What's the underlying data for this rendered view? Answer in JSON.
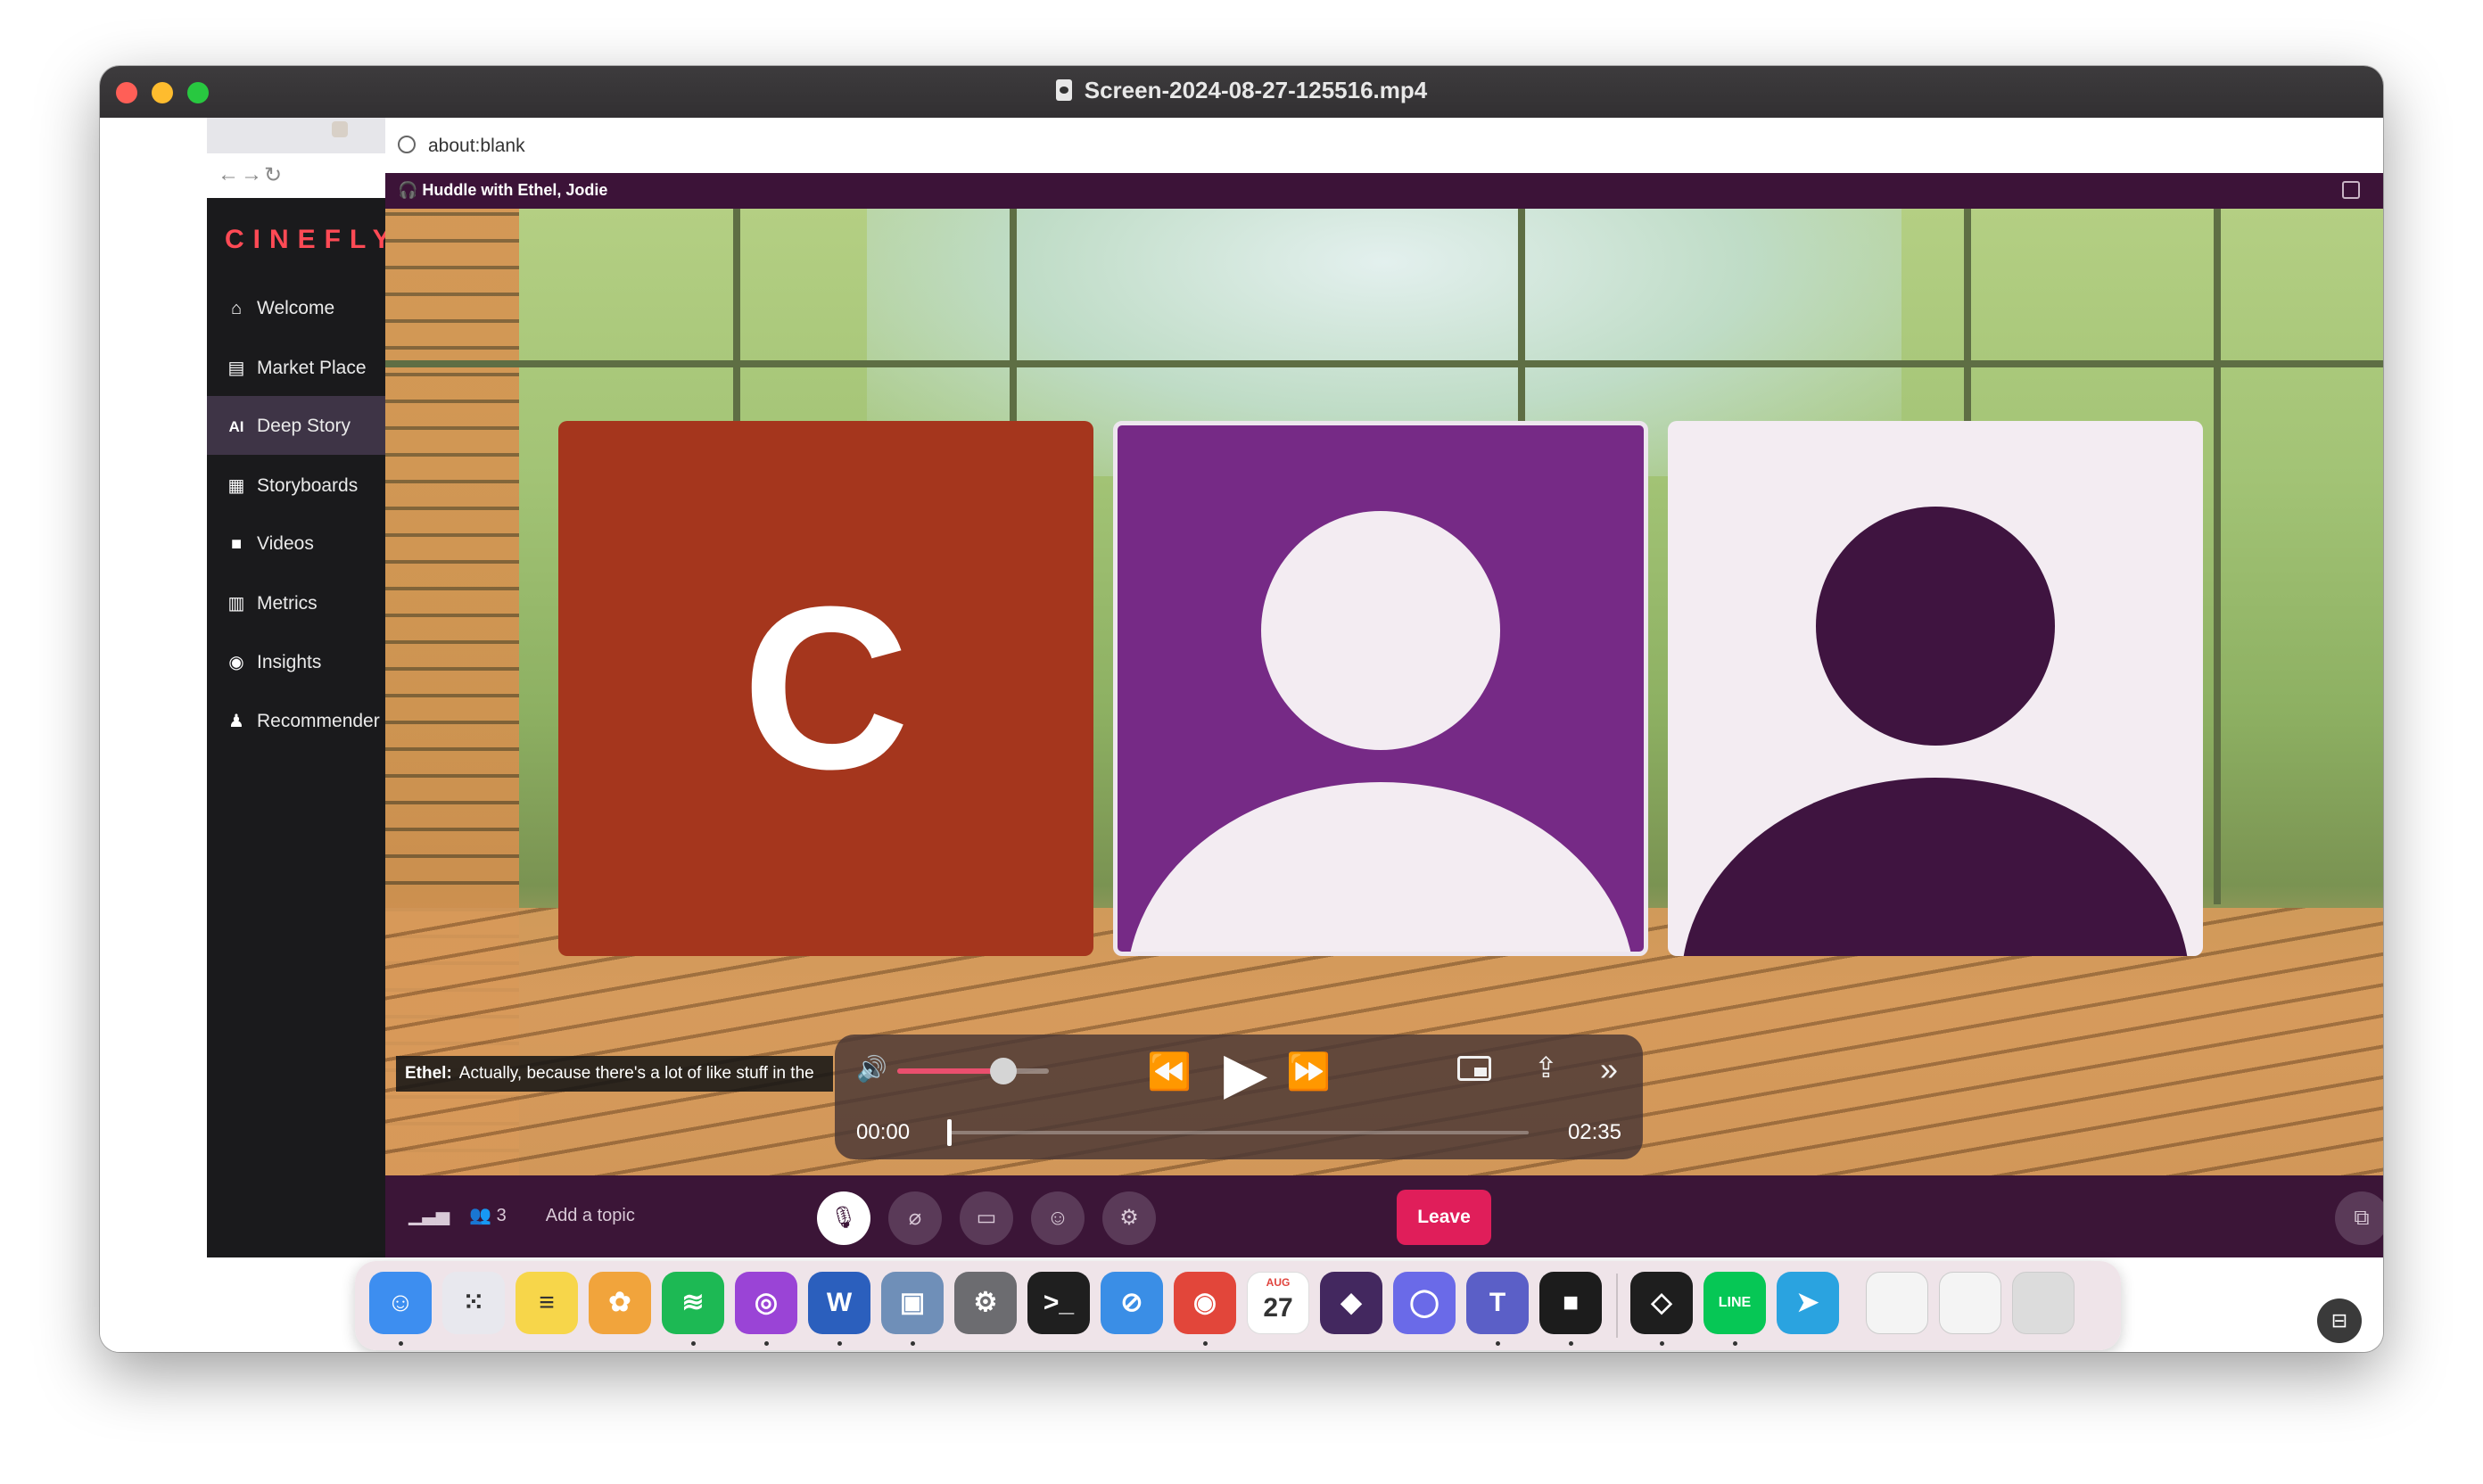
{
  "window": {
    "title": "Screen-2024-08-27-125516.mp4"
  },
  "browser": {
    "url": "about:blank"
  },
  "app": {
    "logo": "CINEFLY",
    "nav": [
      {
        "label": "Welcome",
        "icon": "home-icon",
        "glyph": "⌂"
      },
      {
        "label": "Market Place",
        "icon": "store-icon",
        "glyph": "▤"
      },
      {
        "label": "Deep Story",
        "icon": "ai-icon",
        "glyph": "AI",
        "active": true
      },
      {
        "label": "Storyboards",
        "icon": "grid-icon",
        "glyph": "▦"
      },
      {
        "label": "Videos",
        "icon": "video-icon",
        "glyph": "■"
      },
      {
        "label": "Metrics",
        "icon": "chart-icon",
        "glyph": "▥"
      },
      {
        "label": "Insights",
        "icon": "eye-icon",
        "glyph": "◉"
      },
      {
        "label": "Recommender",
        "icon": "person-icon",
        "glyph": "♟"
      }
    ]
  },
  "huddle": {
    "title": "Huddle with Ethel, Jodie",
    "participants": [
      {
        "type": "initial",
        "letter": "C",
        "color": "#a5361d"
      },
      {
        "type": "avatar",
        "color": "#762a86"
      },
      {
        "type": "avatar",
        "color": "#f3ecf2"
      }
    ],
    "caption": {
      "speaker": "Ethel:",
      "text": "Actually, because there's a lot of like stuff in the"
    },
    "bottom": {
      "participant_count": "3",
      "topic_placeholder": "Add a topic",
      "leave_label": "Leave"
    }
  },
  "player": {
    "current_time": "00:00",
    "duration": "02:35",
    "progress": 0,
    "volume": 0.7
  },
  "dock": {
    "apps": [
      {
        "name": "finder-icon",
        "glyph": "☺",
        "color": "#3d8ef0",
        "running": true
      },
      {
        "name": "launchpad-icon",
        "glyph": "⁙",
        "color": "#e8e8ee",
        "running": false
      },
      {
        "name": "notes-icon",
        "glyph": "≡",
        "color": "#f7d64a",
        "running": false
      },
      {
        "name": "photos-icon",
        "glyph": "✿",
        "color": "#f1a43c",
        "running": false
      },
      {
        "name": "spotify-icon",
        "glyph": "≋",
        "color": "#1db954",
        "running": true
      },
      {
        "name": "podcasts-icon",
        "glyph": "◎",
        "color": "#9a44d6",
        "running": true
      },
      {
        "name": "word-icon",
        "glyph": "W",
        "color": "#2b5fbd",
        "running": true
      },
      {
        "name": "preview-icon",
        "glyph": "▣",
        "color": "#6f8fb8",
        "running": true
      },
      {
        "name": "system-settings-icon",
        "glyph": "⚙",
        "color": "#6c6c70",
        "running": false
      },
      {
        "name": "terminal-icon",
        "glyph": ">_",
        "color": "#1f1f1f",
        "running": false
      },
      {
        "name": "safari-icon",
        "glyph": "⊘",
        "color": "#3a8ee6",
        "running": false
      },
      {
        "name": "chrome-icon",
        "glyph": "◉",
        "color": "#e2463a",
        "running": true
      },
      {
        "name": "calendar-icon",
        "glyph": "27",
        "color": "#ffffff",
        "running": false
      },
      {
        "name": "obsidian-icon",
        "glyph": "◆",
        "color": "#43285f",
        "running": false
      },
      {
        "name": "signal-icon",
        "glyph": "◯",
        "color": "#6a6ae8",
        "running": false
      },
      {
        "name": "teams-icon",
        "glyph": "T",
        "color": "#5b5fc7",
        "running": true
      },
      {
        "name": "screen-recorder-icon",
        "glyph": "■",
        "color": "#1c1c1c",
        "running": true
      },
      {
        "name": "zoom-out-app-icon",
        "glyph": "◇",
        "color": "#1e1e1e",
        "running": true
      },
      {
        "name": "line-icon",
        "glyph": "LINE",
        "color": "#06c755",
        "running": true
      },
      {
        "name": "telegram-icon",
        "glyph": "➤",
        "color": "#2aa3e0",
        "running": false
      }
    ],
    "calendar_month": "AUG"
  }
}
